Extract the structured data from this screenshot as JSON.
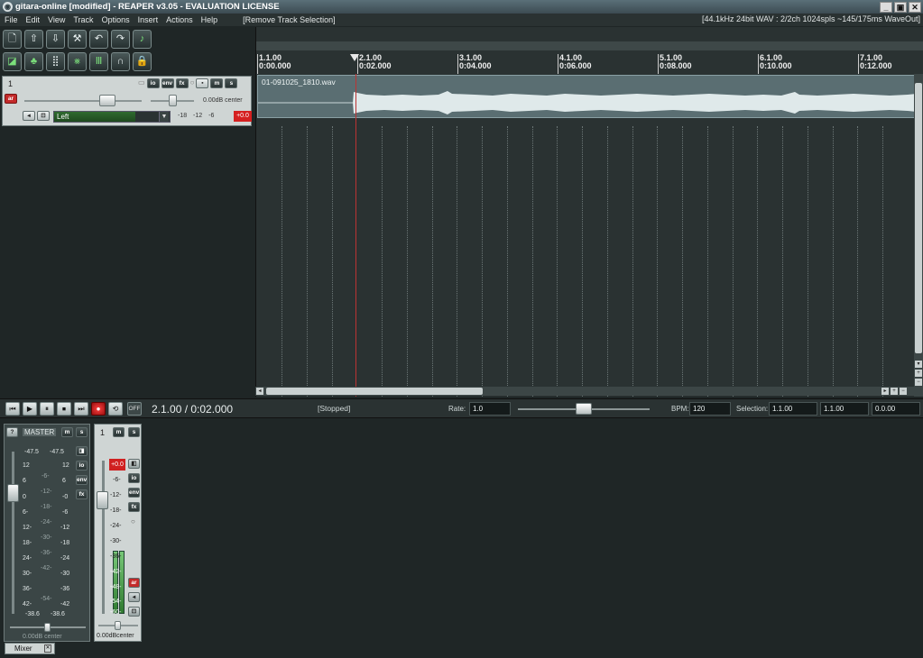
{
  "window": {
    "title": "gitara-online [modified] - REAPER v3.05 - EVALUATION LICENSE",
    "app_icon": "reaper-logo-icon",
    "controls": {
      "minimize": "_",
      "maximize": "▣",
      "close": "✕"
    }
  },
  "menubar": {
    "items": [
      "File",
      "Edit",
      "View",
      "Track",
      "Options",
      "Insert",
      "Actions",
      "Help"
    ],
    "last_action": "[Remove Track Selection]",
    "status": "[44.1kHz 24bit WAV : 2/2ch 1024spls ~145/175ms WaveOut]"
  },
  "toolbar": {
    "buttons": [
      {
        "icon": "new-project-icon",
        "glyph": "🗋"
      },
      {
        "icon": "open-project-icon",
        "glyph": "⇧"
      },
      {
        "icon": "save-project-icon",
        "glyph": "⇩"
      },
      {
        "icon": "project-settings-icon",
        "glyph": "⚒"
      },
      {
        "icon": "undo-icon",
        "glyph": "↶"
      },
      {
        "icon": "redo-icon",
        "glyph": "↷"
      },
      {
        "icon": "metronome-icon",
        "glyph": "♪"
      },
      {
        "icon": "ripple-edit-icon",
        "glyph": "◪"
      },
      {
        "icon": "grouping-icon",
        "glyph": "♣"
      },
      {
        "icon": "snap-grid-icon",
        "glyph": "⣿"
      },
      {
        "icon": "auto-crossfade-icon",
        "glyph": "⨳"
      },
      {
        "icon": "envelope-lock-icon",
        "glyph": "Ⅲ"
      },
      {
        "icon": "loop-icon",
        "glyph": "∩"
      },
      {
        "icon": "lock-icon",
        "glyph": "🔒"
      }
    ]
  },
  "track": {
    "number": "1",
    "volume_readout": "0.00dB center",
    "input": "Left",
    "meter_scale": "-18 -12 -6",
    "peak": "+0.0",
    "buttons": {
      "io": "io",
      "env": "env",
      "fx": "fx",
      "mute": "m",
      "solo": "s",
      "arm": "ar"
    },
    "volume_fraction": 0.74,
    "pan_fraction": 0.5
  },
  "ruler": {
    "marks": [
      {
        "bar": "1.1.00",
        "time": "0:00.000"
      },
      {
        "bar": "2.1.00",
        "time": "0:02.000"
      },
      {
        "bar": "3.1.00",
        "time": "0:04.000"
      },
      {
        "bar": "4.1.00",
        "time": "0:06.000"
      },
      {
        "bar": "5.1.00",
        "time": "0:08.000"
      },
      {
        "bar": "6.1.00",
        "time": "0:10.000"
      },
      {
        "bar": "7.1.00",
        "time": "0:12.000"
      }
    ]
  },
  "item": {
    "name": "01-091025_1810.wav"
  },
  "transport": {
    "position": "2.1.00 / 0:02.000",
    "state": "[Stopped]",
    "rate_label": "Rate:",
    "rate_value": "1.0",
    "bpm_label": "BPM:",
    "bpm_value": "120",
    "selection_label": "Selection:",
    "selection_start": "1.1.00",
    "selection_end": "1.1.00",
    "selection_length": "0.0.00",
    "repeat_label": "OFF",
    "buttons": [
      "⏮",
      "▶",
      "⏸",
      "⏹",
      "⏭"
    ]
  },
  "mixer": {
    "tab_label": "Mixer",
    "master": {
      "label": "MASTER",
      "peak_left": "-47.5",
      "peak_right": "-47.5",
      "scale_left": [
        "12",
        "6",
        "0",
        "6-",
        "12-",
        "18-",
        "24-",
        "30-",
        "36-",
        "42-"
      ],
      "scale_mid": [
        "-6-",
        "-12-",
        "-18-",
        "-24-",
        "-30-",
        "-36-",
        "-42-",
        "-54-"
      ],
      "scale_right": [
        "12",
        "6",
        "-0",
        "-6",
        "-12",
        "-18",
        "-24",
        "-30",
        "-36",
        "-42"
      ],
      "bottom_left": "-38.6",
      "bottom_right": "-38.6",
      "pan_readout": "0.00dB center"
    },
    "track1": {
      "number": "1",
      "peak": "+0.0",
      "scale": [
        "-6-",
        "-12-",
        "-18-",
        "-24-",
        "-30-",
        "-36-",
        "-42-",
        "-48-",
        "-54-",
        "-60-"
      ],
      "readout": "0.00dBcenter"
    }
  }
}
